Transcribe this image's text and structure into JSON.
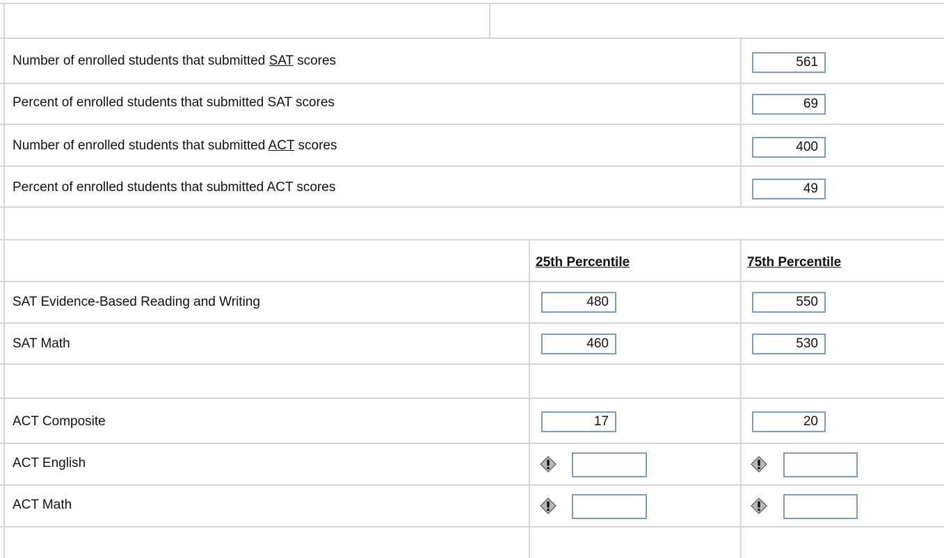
{
  "submitted": {
    "sat_count": {
      "label_pre": "Number of enrolled students that submitted ",
      "label_abbr": "SAT",
      "label_post": " scores",
      "value": "561"
    },
    "sat_percent": {
      "label": "Percent of enrolled students that submitted SAT scores",
      "value": "69"
    },
    "act_count": {
      "label_pre": "Number of enrolled students that submitted ",
      "label_abbr": "ACT",
      "label_post": " scores",
      "value": "400"
    },
    "act_percent": {
      "label": "Percent of enrolled students that submitted ACT scores",
      "value": "49"
    }
  },
  "percentiles": {
    "header_25": "25th Percentile",
    "header_75": "75th Percentile",
    "rows": [
      {
        "label": "SAT Evidence-Based Reading and Writing",
        "p25": "480",
        "p75": "550"
      },
      {
        "label": "SAT Math",
        "p25": "460",
        "p75": "530"
      },
      {
        "label": "ACT Composite",
        "p25": "17",
        "p75": "20"
      },
      {
        "label": "ACT English",
        "p25": "",
        "p75": "",
        "warning": true
      },
      {
        "label": "ACT Math",
        "p25": "",
        "p75": "",
        "warning": true
      }
    ]
  },
  "icons": {
    "warning": "warning-icon"
  },
  "colors": {
    "field_border": "#7f9db9",
    "grid_line": "#d6d6d6",
    "warning_fill": "#b8b8b8"
  }
}
